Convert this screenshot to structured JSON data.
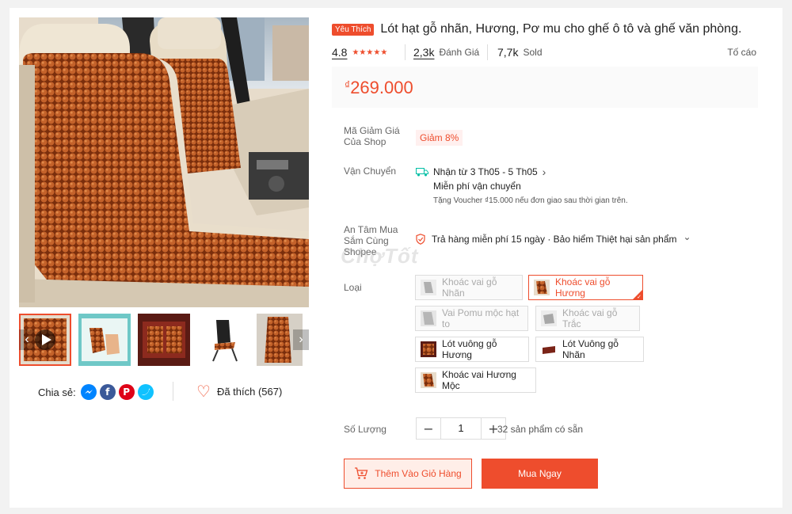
{
  "gallery": {
    "thumbnails": [
      {
        "alt": "thumb-1"
      },
      {
        "alt": "thumb-2"
      },
      {
        "alt": "thumb-3"
      },
      {
        "alt": "thumb-4"
      },
      {
        "alt": "thumb-5"
      }
    ],
    "prev_icon": "chevron-left-icon",
    "next_icon": "chevron-right-icon"
  },
  "share": {
    "label": "Chia sẻ:",
    "icons": [
      "messenger-icon",
      "facebook-icon",
      "pinterest-icon",
      "twitter-icon"
    ],
    "facebook_glyph": "f",
    "pinterest_glyph": "P"
  },
  "like": {
    "label": "Đã thích (567)"
  },
  "product": {
    "badge": "Yêu Thích",
    "title": "Lót hạt gỗ nhãn, Hương, Pơ mu cho ghế ô tô và ghế văn phòng.",
    "rating": "4.8",
    "rating_stars": 5,
    "reviews_count": "2,3k",
    "reviews_label": "Đánh Giá",
    "sold_count": "7,7k",
    "sold_label": "Sold",
    "report_label": "Tố cáo",
    "currency": "₫",
    "price": "269.000"
  },
  "voucher": {
    "label": "Mã Giảm Giá Của Shop",
    "value": "Giảm 8%"
  },
  "shipping": {
    "label": "Vận Chuyển",
    "eta": "Nhận từ 3 Th05 - 5 Th05",
    "chevron": "›",
    "free_label": "Miễn phí vận chuyển",
    "note": "Tặng Voucher ₫15.000 nếu đơn giao sau thời gian trên."
  },
  "guarantee": {
    "label": "An Tâm Mua Sắm Cùng Shopee",
    "text": "Trả hàng miễn phí 15 ngày · Bảo hiểm Thiệt hại sản phẩm",
    "chevron": "⌄"
  },
  "variants": {
    "label": "Loại",
    "options": [
      {
        "label": "Khoác vai gỗ Nhãn",
        "state": "disabled"
      },
      {
        "label": "Khoác vai gỗ Hương",
        "state": "selected"
      },
      {
        "label": "Vai Pomu mộc hạt to",
        "state": "disabled"
      },
      {
        "label": "Khoác vai gỗ Trắc",
        "state": "disabled"
      },
      {
        "label": "Lót vuông gỗ Hương",
        "state": "available"
      },
      {
        "label": "Lót Vuông gỗ Nhãn",
        "state": "available"
      },
      {
        "label": "Khoác vai Hương Mộc",
        "state": "available"
      }
    ]
  },
  "quantity": {
    "label": "Số Lượng",
    "minus": "−",
    "value": "1",
    "plus": "+",
    "stock": "32 sản phẩm có sẵn"
  },
  "actions": {
    "add_to_cart": "Thêm Vào Giỏ Hàng",
    "buy_now": "Mua Ngay"
  },
  "watermark": "ChợTốt",
  "colors": {
    "accent": "#ee4d2d",
    "wood": "#b5531f"
  }
}
